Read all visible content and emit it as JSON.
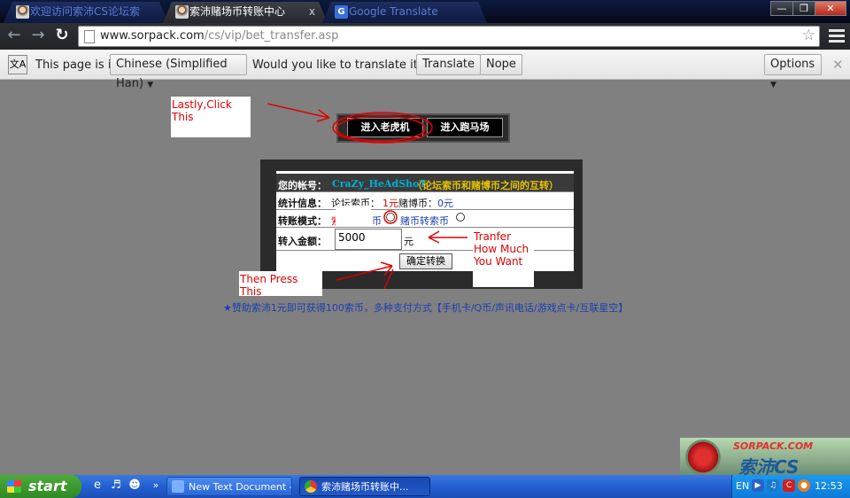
{
  "browser": {
    "tabs": [
      {
        "title": "欢迎访问索沛CS论坛索",
        "active": false,
        "icon": "person-favicon"
      },
      {
        "title": "索沛赌场币转账中心",
        "active": true,
        "icon": "person-favicon"
      },
      {
        "title": "Google Translate",
        "active": false,
        "icon": "google-translate-favicon"
      }
    ],
    "tab_close_glyph": "x",
    "window_controls": {
      "minimize": "—",
      "maximize": "❐",
      "close": "✕"
    },
    "url_host": "www.sorpack.com",
    "url_path": "/cs/vip/bet_transfer.asp"
  },
  "translate_bar": {
    "prefix": "This page is in",
    "language_select": "Chinese (Simplified Han)",
    "question": "Would you like to translate it?",
    "translate_label": "Translate",
    "nope_label": "Nope",
    "options_label": "Options"
  },
  "page": {
    "annotations": {
      "click_note": "Lastly,Click This",
      "amount_note": "Tranfer How Much You Want",
      "press_note": "Then Press This"
    },
    "buttons": {
      "slot_machine": "进入老虎机",
      "horse_racing": "进入跑马场"
    },
    "form": {
      "account_label": "您的帐号：",
      "account_value": "CraZy_HeAdShoT",
      "account_note": "（论坛索币和赌博币之间的互转）",
      "stats_label": "统计信息：",
      "stats_forum": "论坛索币：",
      "stats_forum_value": "1元",
      "stats_bet": " 赌博币：",
      "stats_bet_value": "0元",
      "mode_label": "转账模式：",
      "mode_option1_prefix": "索",
      "mode_option1_suffix": "币",
      "mode_option2": "赌币转索币",
      "amount_label": "转入金额：",
      "amount_value": "5000",
      "amount_unit": "元",
      "submit_label": "确定转换"
    },
    "footer": "★赞助索沛1元即可获得100索币，多种支付方式【手机卡/Q币/声讯电话/游戏点卡/互联星空】"
  },
  "watermark": {
    "site": "SORPACK.COM",
    "brand": "索沛CS"
  },
  "taskbar": {
    "start_label": "start",
    "overflow": "»",
    "tasks": [
      {
        "label": "New Text Document -...",
        "pressed": false
      },
      {
        "label": "索沛赌场币转账中...",
        "pressed": true
      }
    ],
    "language": "EN",
    "clock": "12:53"
  },
  "colors": {
    "annotation_red": "#e00000",
    "account_cyan": "#00b0d8",
    "account_note_yellow": "#e8c400",
    "link_blue": "#1a3fb0"
  }
}
